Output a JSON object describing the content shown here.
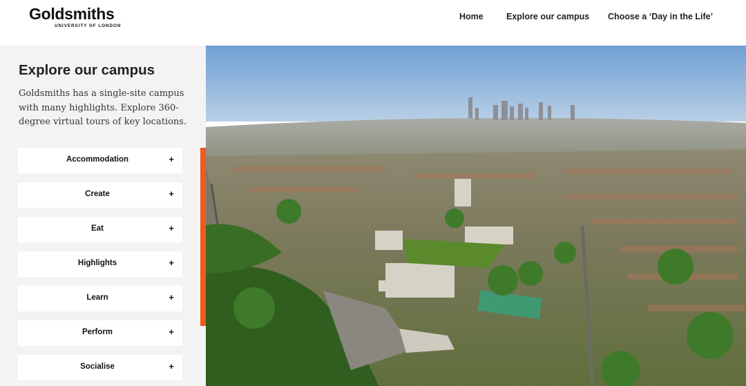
{
  "header": {
    "logo": {
      "name": "Goldsmiths",
      "subtitle": "UNIVERSITY OF LONDON"
    },
    "nav": [
      {
        "label": "Home"
      },
      {
        "label": "Explore our campus"
      },
      {
        "label": "Choose a ‘Day in the Life’"
      }
    ]
  },
  "sidebar": {
    "title": "Explore our campus",
    "description": "Goldsmiths has a single-site campus with many highlights. Explore 360-degree virtual tours of key locations.",
    "expand_icon": "plus-icon",
    "items": [
      {
        "label": "Accommodation",
        "icon": "+"
      },
      {
        "label": "Create",
        "icon": "+"
      },
      {
        "label": "Eat",
        "icon": "+"
      },
      {
        "label": "Highlights",
        "icon": "+"
      },
      {
        "label": "Learn",
        "icon": "+"
      },
      {
        "label": "Perform",
        "icon": "+"
      },
      {
        "label": "Socialise",
        "icon": "+"
      }
    ]
  },
  "colors": {
    "accent": "#ef5a1f",
    "sidebar_bg": "#f3f3f3",
    "sky": "#7aa6d6",
    "foliage": "#3f7a2a"
  }
}
